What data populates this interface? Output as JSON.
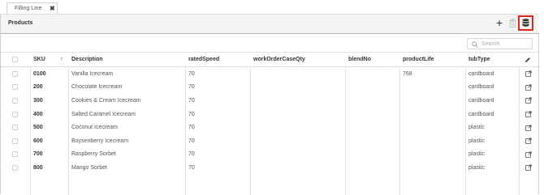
{
  "tab": {
    "label": "Filling Line",
    "close": "✖"
  },
  "panel": {
    "title": "Products",
    "add_label": "+"
  },
  "search": {
    "placeholder": "Search",
    "value": ""
  },
  "table": {
    "sort_indicator": "↑",
    "columns": [
      "SKU",
      "Description",
      "ratedSpeed",
      "workOrderCaseQty",
      "blendNo",
      "productLife",
      "tubType"
    ],
    "rows": [
      {
        "sku": "0100",
        "description": "Vanilla Icecream",
        "ratedSpeed": "70",
        "workOrderCaseQty": "",
        "blendNo": "",
        "productLife": "768",
        "tubType": "cardboard"
      },
      {
        "sku": "200",
        "description": "Chocolate Icecream",
        "ratedSpeed": "70",
        "workOrderCaseQty": "",
        "blendNo": "",
        "productLife": "",
        "tubType": "cardboard"
      },
      {
        "sku": "300",
        "description": "Cookies & Cream Icecream",
        "ratedSpeed": "70",
        "workOrderCaseQty": "",
        "blendNo": "",
        "productLife": "",
        "tubType": "cardboard"
      },
      {
        "sku": "400",
        "description": "Salted Caramel Icecream",
        "ratedSpeed": "70",
        "workOrderCaseQty": "",
        "blendNo": "",
        "productLife": "",
        "tubType": "cardboard"
      },
      {
        "sku": "500",
        "description": "Coconut Icecream",
        "ratedSpeed": "70",
        "workOrderCaseQty": "",
        "blendNo": "",
        "productLife": "",
        "tubType": "plastic"
      },
      {
        "sku": "600",
        "description": "Boysenberry Icecream",
        "ratedSpeed": "70",
        "workOrderCaseQty": "",
        "blendNo": "",
        "productLife": "",
        "tubType": "plastic"
      },
      {
        "sku": "700",
        "description": "Raspberry Sorbet",
        "ratedSpeed": "70",
        "workOrderCaseQty": "",
        "blendNo": "",
        "productLife": "",
        "tubType": "plastic"
      },
      {
        "sku": "800",
        "description": "Mango Sorbet",
        "ratedSpeed": "70",
        "workOrderCaseQty": "",
        "blendNo": "",
        "productLife": "",
        "tubType": "plastic"
      }
    ]
  },
  "icons": {
    "tab_close": "close-icon",
    "add": "plus-icon",
    "delete": "trash-icon",
    "database": "database-icon",
    "search": "search-icon",
    "edit_header": "pencil-icon",
    "row_edit": "external-edit-icon",
    "sort": "sort-ascending-icon"
  },
  "colors": {
    "highlight_border": "#d9281f",
    "header_bg": "#f4f4f4"
  }
}
